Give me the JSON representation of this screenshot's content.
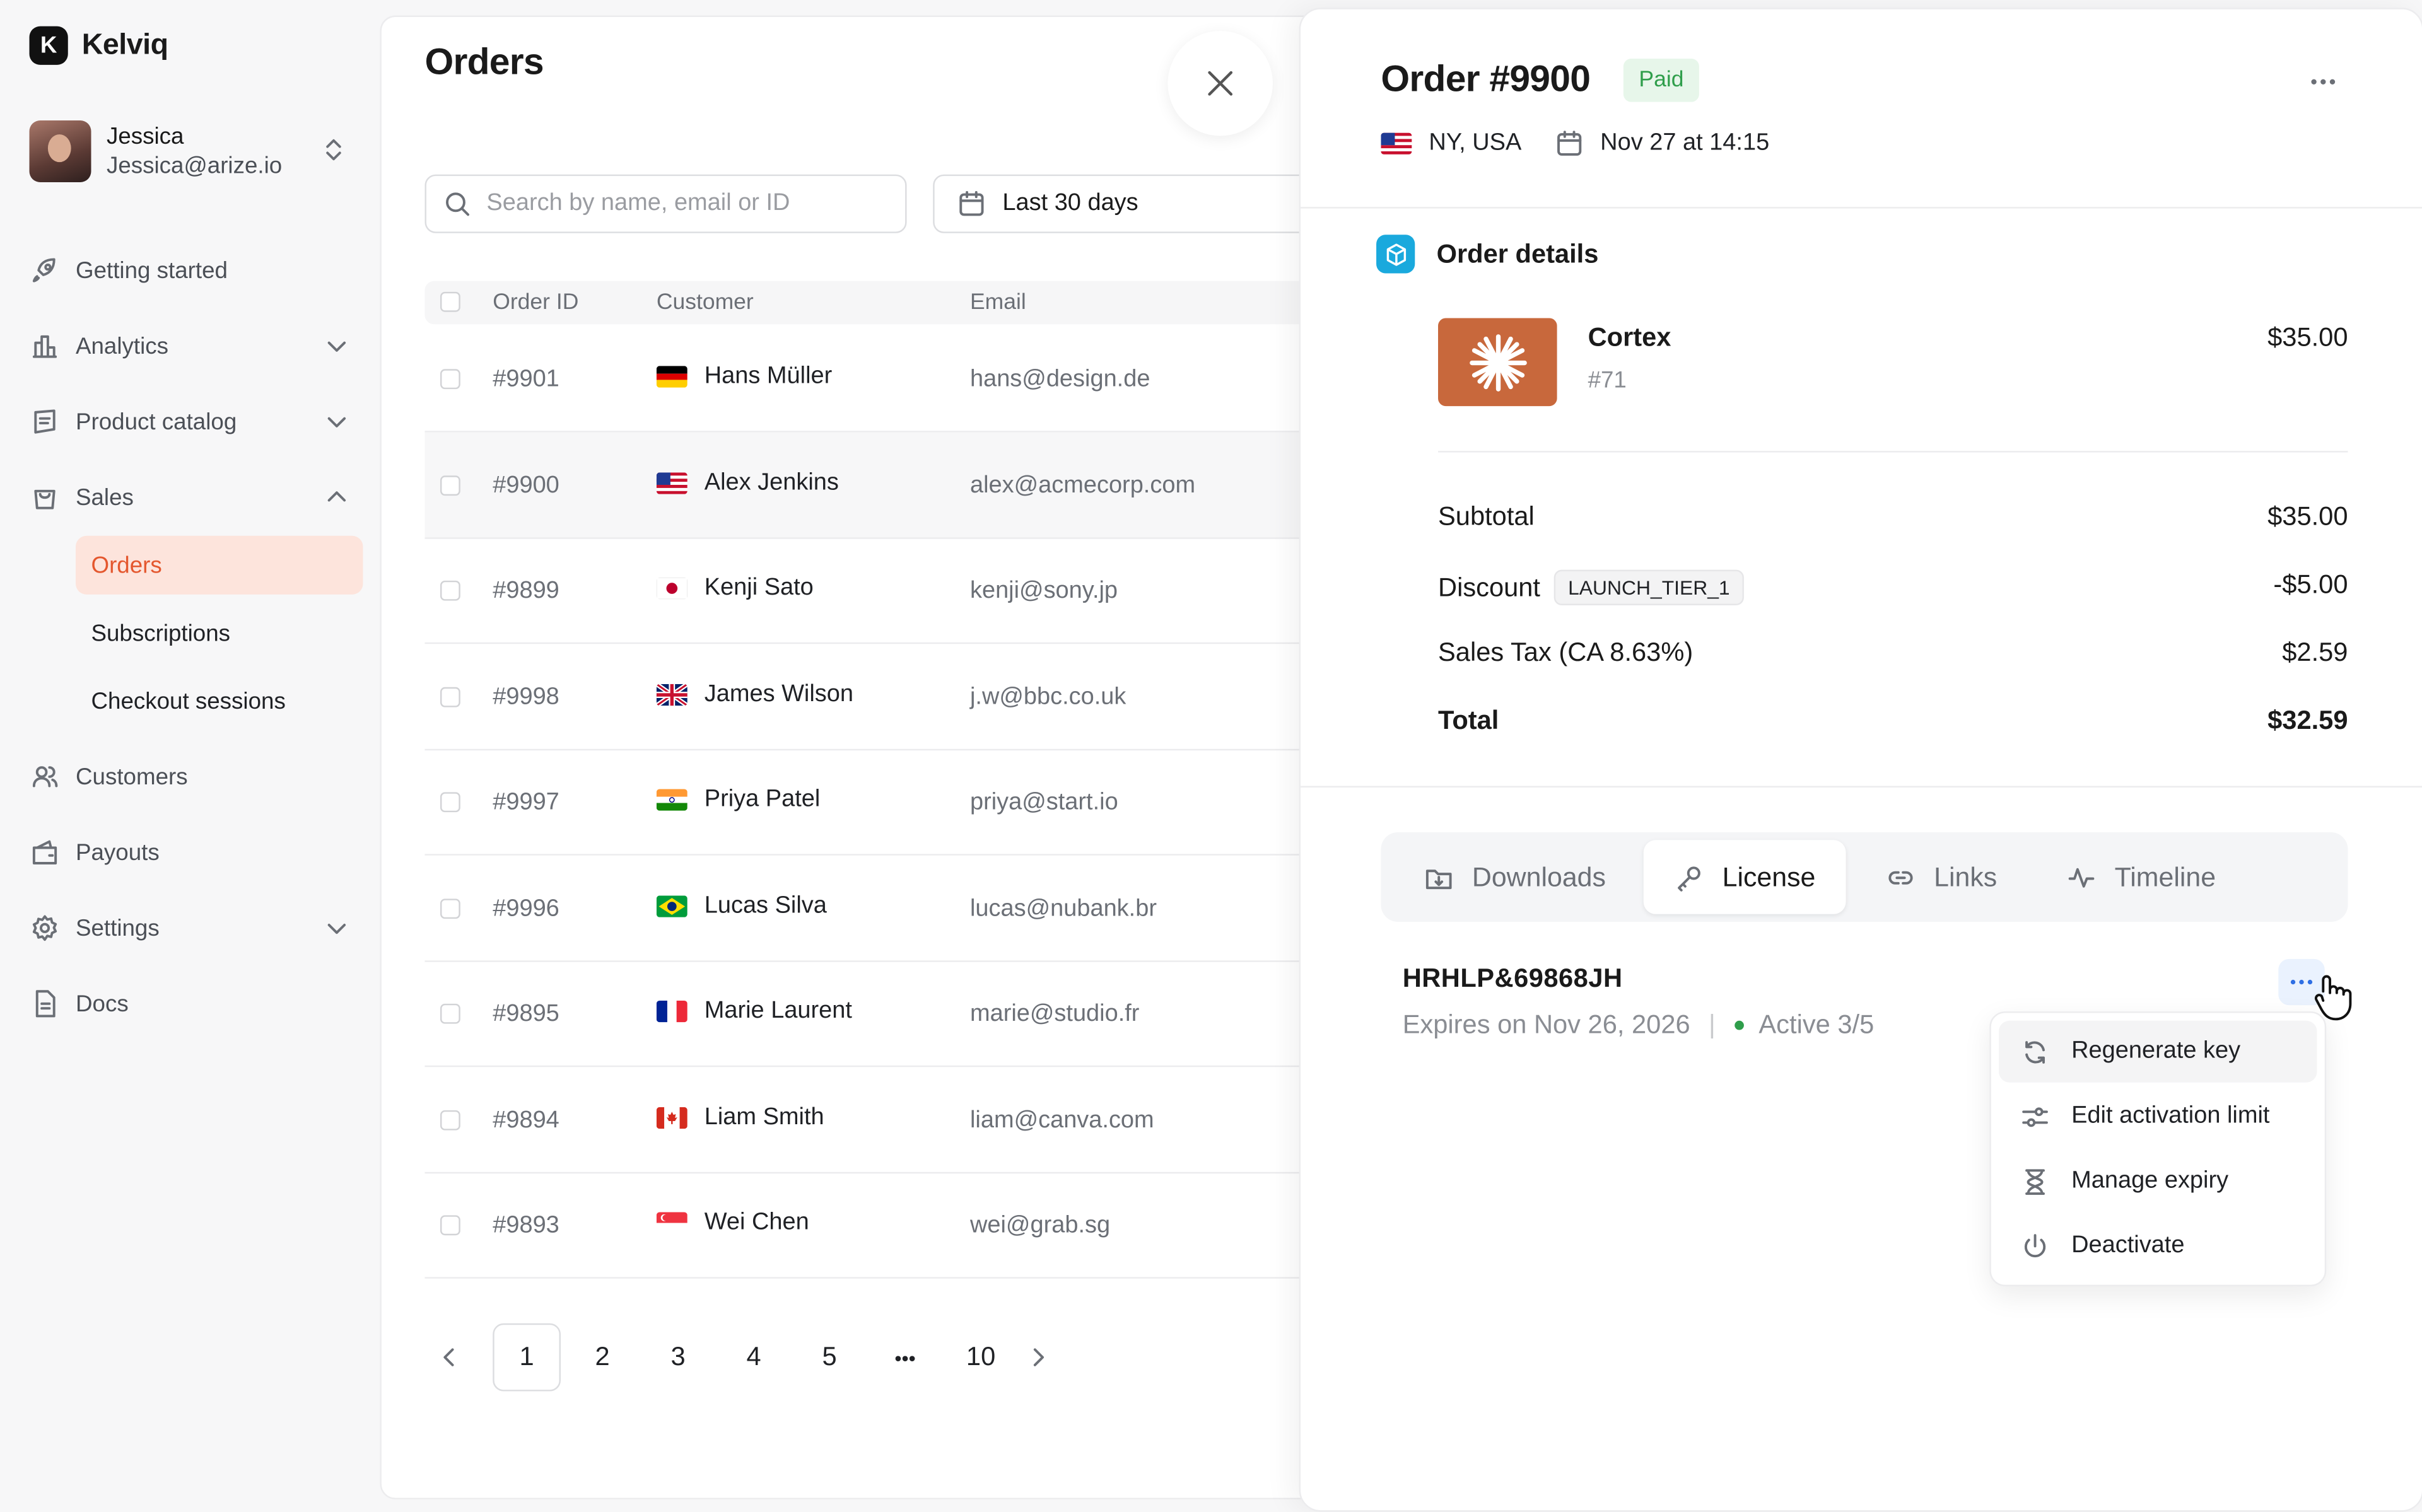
{
  "app": {
    "name": "Kelviq",
    "logo_letter": "K"
  },
  "user": {
    "name": "Jessica",
    "email": "Jessica@arize.io"
  },
  "nav": {
    "getting_started": "Getting started",
    "analytics": "Analytics",
    "product_catalog": "Product catalog",
    "sales": "Sales",
    "sales_items": {
      "orders": "Orders",
      "subscriptions": "Subscriptions",
      "checkout_sessions": "Checkout sessions"
    },
    "customers": "Customers",
    "payouts": "Payouts",
    "settings": "Settings",
    "docs": "Docs"
  },
  "orders": {
    "title": "Orders",
    "search_placeholder": "Search by name, email or ID",
    "date_filter": "Last 30 days",
    "columns": {
      "order_id": "Order ID",
      "customer": "Customer",
      "email": "Email"
    },
    "rows": [
      {
        "id": "#9901",
        "customer": "Hans Müller",
        "email": "hans@design.de",
        "flag": "de"
      },
      {
        "id": "#9900",
        "customer": "Alex Jenkins",
        "email": "alex@acmecorp.com",
        "flag": "us"
      },
      {
        "id": "#9899",
        "customer": "Kenji Sato",
        "email": "kenji@sony.jp",
        "flag": "jp"
      },
      {
        "id": "#9998",
        "customer": "James Wilson",
        "email": "j.w@bbc.co.uk",
        "flag": "gb"
      },
      {
        "id": "#9997",
        "customer": "Priya Patel",
        "email": "priya@start.io",
        "flag": "in"
      },
      {
        "id": "#9996",
        "customer": "Lucas Silva",
        "email": "lucas@nubank.br",
        "flag": "br"
      },
      {
        "id": "#9895",
        "customer": "Marie Laurent",
        "email": "marie@studio.fr",
        "flag": "fr"
      },
      {
        "id": "#9894",
        "customer": "Liam Smith",
        "email": "liam@canva.com",
        "flag": "ca"
      },
      {
        "id": "#9893",
        "customer": "Wei Chen",
        "email": "wei@grab.sg",
        "flag": "sg"
      }
    ],
    "pagination": {
      "pages": [
        "1",
        "2",
        "3",
        "4",
        "5"
      ],
      "ellipsis": "•••",
      "last": "10",
      "current": "1"
    }
  },
  "order_detail": {
    "title": "Order #9900",
    "status": "Paid",
    "location": "NY, USA",
    "date": "Nov 27 at 14:15",
    "section_title": "Order details",
    "product": {
      "name": "Cortex",
      "sku": "#71",
      "price": "$35.00"
    },
    "subtotal_label": "Subtotal",
    "subtotal": "$35.00",
    "discount_label": "Discount",
    "discount_code": "LAUNCH_TIER_1",
    "discount": "-$5.00",
    "tax_label": "Sales Tax (CA 8.63%)",
    "tax": "$2.59",
    "total_label": "Total",
    "total": "$32.59",
    "tabs": {
      "downloads": "Downloads",
      "license": "License",
      "links": "Links",
      "timeline": "Timeline"
    },
    "license": {
      "key": "HRHLP&69868JH",
      "expires": "Expires on Nov 26, 2026",
      "separator": "|",
      "activations": "Active 3/5"
    },
    "menu": {
      "regenerate": "Regenerate key",
      "edit_limit": "Edit activation limit",
      "manage_expiry": "Manage expiry",
      "deactivate": "Deactivate"
    }
  },
  "colors": {
    "accent": "#e4572e",
    "accent_bg": "#fde4dc",
    "paid_green": "#2f9e4b",
    "info_blue": "#1aa9dd",
    "product_orange": "#c8683c"
  }
}
